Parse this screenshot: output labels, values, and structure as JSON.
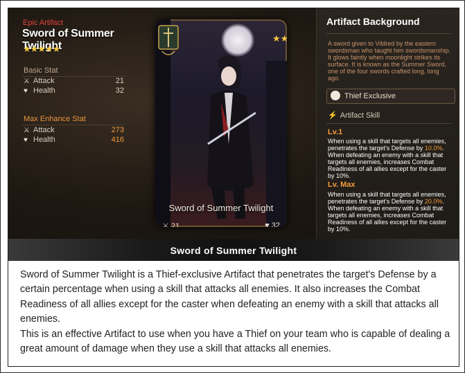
{
  "left_panel": {
    "rarity": "Epic Artifact",
    "name": "Sword of Summer Twilight",
    "stars": "★★★★★",
    "basic_stat_label": "Basic Stat",
    "basic_stats": [
      {
        "label": "Attack",
        "value": "21",
        "icon": "sword-icon"
      },
      {
        "label": "Health",
        "value": "32",
        "icon": "heart-icon"
      }
    ],
    "max_stat_label": "Max Enhance Stat",
    "max_stats": [
      {
        "label": "Attack",
        "value": "273",
        "icon": "sword-icon"
      },
      {
        "label": "Health",
        "value": "416",
        "icon": "heart-icon"
      }
    ]
  },
  "card": {
    "name": "Sword of Summer Twilight",
    "attack": "21",
    "health": "32",
    "stars": "★★★★★"
  },
  "right_panel": {
    "title": "Artifact Background",
    "background": "A sword given to Vildred by the eastern swordsman who taught him swordsmanship. It glows faintly when moonlight strikes its surface. It is known as the Summer Sword, one of the four swords crafted long, long ago.",
    "exclusive": "Thief Exclusive",
    "skill_header": "Artifact Skill",
    "lv1_label": "Lv.1",
    "lv1_pre": "When using a skill that targets all enemies, penetrates the target's Defense by ",
    "lv1_pct": "10.0%",
    "lv1_post": ". When defeating an enemy with a skill that targets all enemies, increases Combat Readiness of all allies except for the caster by 10%.",
    "lvmax_label": "Lv. Max",
    "lvmax_pre": "When using a skill that targets all enemies, penetrates the target's Defense by ",
    "lvmax_pct": "20.0%",
    "lvmax_post": ". When defeating an enemy with a skill that targets all enemies, increases Combat Readiness of all allies except for the caster by 10%."
  },
  "banner": {
    "title": "Sword of Summer Twilight"
  },
  "description": {
    "p1": "Sword of Summer Twilight is a Thief-exclusive Artifact that penetrates the target's Defense by a certain percentage when using a skill that attacks all enemies. It also increases the Combat Readiness of all allies except for the caster when defeating an enemy with a skill that attacks all enemies.",
    "p2": "This is an effective Artifact to use when you have a Thief on your team who is capable of dealing a great amount of damage when they use a skill that attacks all enemies."
  },
  "colors": {
    "rarity": "#e2413a",
    "accent_orange": "#f39c3a",
    "star": "#f5c842"
  }
}
